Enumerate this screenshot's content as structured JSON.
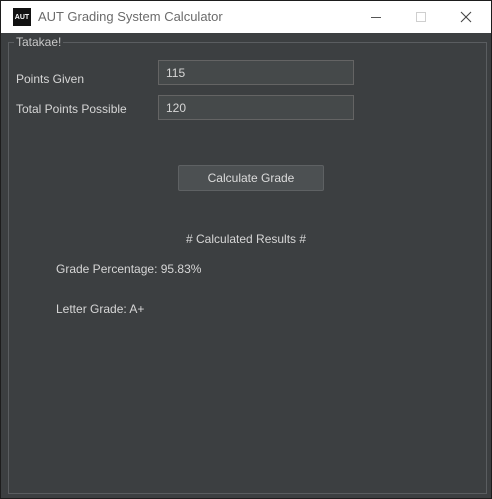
{
  "window": {
    "icon_text": "AUT",
    "title": "AUT Grading System Calculator",
    "controls": {
      "minimize": "–",
      "maximize": "☐",
      "close": "✕"
    }
  },
  "form": {
    "group_title": "Tatakae!",
    "points_given_label": "Points Given",
    "points_given_value": "115",
    "total_points_label": "Total Points Possible",
    "total_points_value": "120",
    "calculate_label": "Calculate Grade"
  },
  "results": {
    "header": "# Calculated Results #",
    "grade_percentage": "Grade Percentage: 95.83%",
    "letter_grade": "Letter Grade: A+"
  }
}
